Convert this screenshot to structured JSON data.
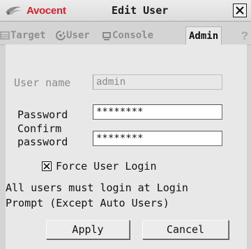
{
  "window": {
    "brand": "Avocent",
    "title": "Edit User"
  },
  "tabs": [
    {
      "label": "Target",
      "icon": "target-icon",
      "active": false
    },
    {
      "label": "User",
      "icon": "user-icon",
      "active": false
    },
    {
      "label": "Console",
      "icon": "console-icon",
      "active": false
    },
    {
      "label": "Admin",
      "icon": "",
      "active": true
    }
  ],
  "help": {
    "label": "?"
  },
  "form": {
    "username_label": "User name",
    "username_value": "admin",
    "password_label": "Password",
    "password_value": "********",
    "confirm_label_line1": "Confirm",
    "confirm_label_line2": "password",
    "confirm_value": "********",
    "force_login_label": "Force User Login",
    "force_login_checked": true,
    "note_line1": "All users must login at Login",
    "note_line2": "Prompt (Except Auto Users)"
  },
  "buttons": {
    "apply": "Apply",
    "cancel": "Cancel"
  },
  "colors": {
    "brand_red": "#d5202b",
    "panel_bg": "#e8e8e8",
    "window_bg": "#d4d4d4"
  }
}
